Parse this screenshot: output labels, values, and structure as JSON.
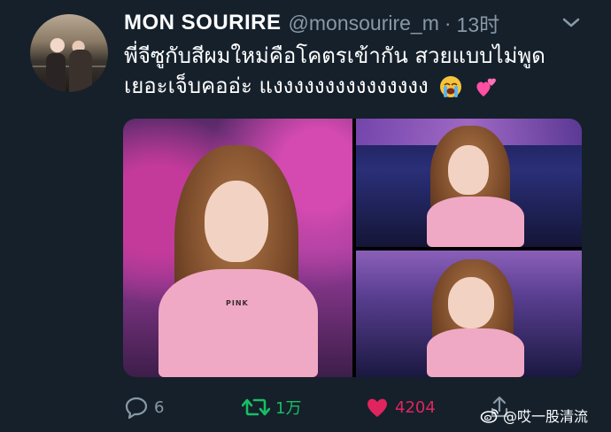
{
  "tweet": {
    "display_name": "MON SOURIRE",
    "handle": "@monsourire_m",
    "separator": "·",
    "time": "13时",
    "text_line_1": "พี่จีซูกับสีผมใหม่คือโคตรเข้ากัน สวยแบบไม่พูด",
    "text_line_2": "เยอะเจ็บคออ่ะ แงงงงงงงงงงงงงงง",
    "emojis": [
      "loudly-crying-face",
      "two-hearts"
    ]
  },
  "media": {
    "photos": [
      {
        "shirt_text": "PINK"
      },
      {
        "shirt_text": ""
      },
      {
        "shirt_text": ""
      }
    ]
  },
  "actions": {
    "reply_count": "6",
    "retweet_count": "1万",
    "like_count": "4204",
    "like_color": "#e0245e",
    "retweet_color": "#17bf63",
    "icon_color": "#8899a6"
  },
  "watermark": {
    "text": "@哎一股清流",
    "logo": "weibo-logo"
  },
  "colors": {
    "background": "#15202b",
    "text": "#ffffff",
    "secondary": "#8899a6"
  }
}
